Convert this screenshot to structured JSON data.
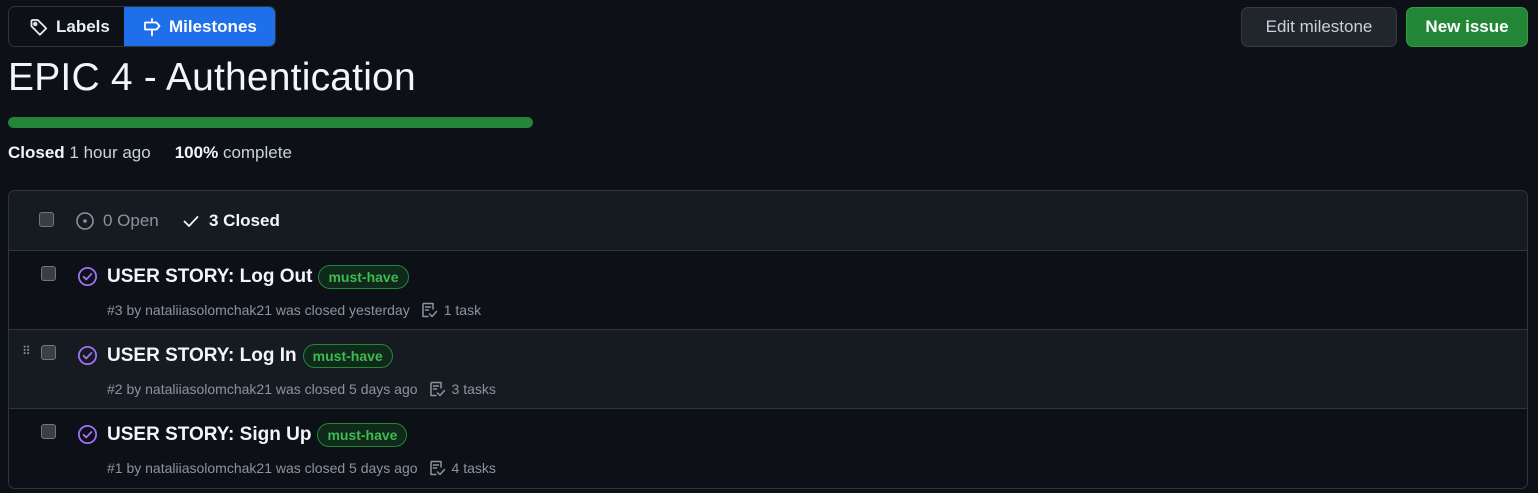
{
  "nav": {
    "labels_label": "Labels",
    "milestones_label": "Milestones"
  },
  "actions": {
    "edit_label": "Edit milestone",
    "new_label": "New issue"
  },
  "milestone": {
    "title": "EPIC 4 - Authentication",
    "progress_percent": 100,
    "status": "Closed",
    "closed_time": "1 hour ago",
    "percent_text": "100%",
    "complete_text": "complete"
  },
  "filters": {
    "open_label": "0 Open",
    "closed_label": "3 Closed"
  },
  "issues": [
    {
      "title": "USER STORY: Log Out",
      "label": "must-have",
      "meta": "#3 by nataliiasolomchak21 was closed yesterday",
      "tasks": "1 task"
    },
    {
      "title": "USER STORY: Log In",
      "label": "must-have",
      "meta": "#2 by nataliiasolomchak21 was closed 5 days ago",
      "tasks": "3 tasks"
    },
    {
      "title": "USER STORY: Sign Up",
      "label": "must-have",
      "meta": "#1 by nataliiasolomchak21 was closed 5 days ago",
      "tasks": "4 tasks"
    }
  ],
  "colors": {
    "background": "#0d1117",
    "accent_blue": "#1f6feb",
    "success_green": "#238636",
    "closed_purple": "#a371f7",
    "label_green": "#3fb950"
  },
  "icons": {
    "labels": "tag-icon",
    "milestones": "milestone-signpost-icon",
    "open": "issue-open-icon",
    "closed": "check-icon",
    "issue_closed": "issue-closed-icon",
    "tasks": "task-list-icon"
  }
}
